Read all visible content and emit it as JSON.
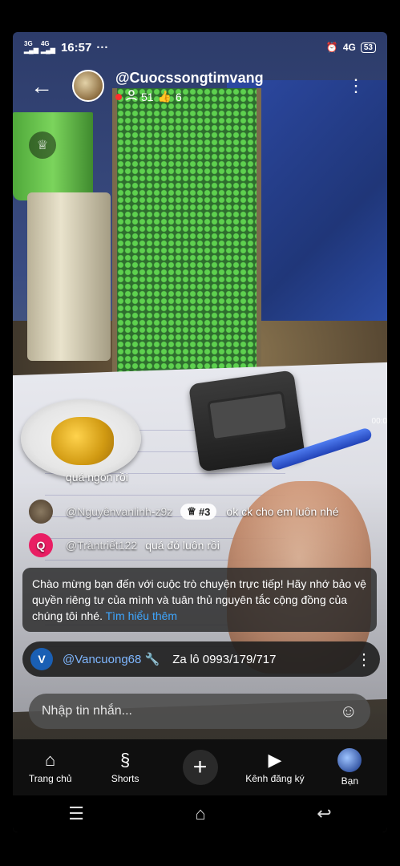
{
  "status_bar": {
    "network1": "3G",
    "network2": "4G",
    "time": "16:57",
    "dots": "···",
    "right_net": "4G",
    "battery": "53"
  },
  "header": {
    "channel_name": "@Cuocssongtimvang",
    "viewers": "51",
    "likes": "6"
  },
  "timestamp": "00:0",
  "chat": [
    {
      "avatar_color": "#6b5ca5",
      "avatar_letter": "",
      "username": "",
      "message": "quá ngon rồi"
    },
    {
      "avatar_color": "#5a4a3a",
      "avatar_letter": "",
      "username": "@Nguyênvanlinh-z9z",
      "badge": "#3",
      "message": "ok ck cho em luôn nhé"
    },
    {
      "avatar_color": "#e91e63",
      "avatar_letter": "Q",
      "username": "@Tràntriết122",
      "message": "quá đỏ luôn rồi"
    }
  ],
  "welcome": {
    "text": "Chào mừng bạn đến với cuộc trò chuyện trực tiếp! Hãy nhớ bảo vệ quyền riêng tư của mình và tuân thủ nguyên tắc cộng đồng của chúng tôi nhé.",
    "link": "Tìm hiểu thêm"
  },
  "pinned": {
    "avatar_letter": "V",
    "username": "@Vancuong68",
    "message": "Za lô 0993/179/717"
  },
  "input": {
    "placeholder": "Nhập tin nhắn..."
  },
  "nav": {
    "home": "Trang chủ",
    "shorts": "Shorts",
    "subscriptions": "Kênh đăng ký",
    "you": "Bạn"
  },
  "colors": {
    "live": "#ff2d2d",
    "link": "#3ea6ff",
    "pinned_name": "#7fb7ff"
  },
  "icons": [
    "back-arrow-icon",
    "person-icon",
    "thumb-up-icon",
    "more-vert-icon",
    "crown-icon",
    "wrench-icon",
    "emoji-icon",
    "home-icon",
    "shorts-icon",
    "plus-icon",
    "subscriptions-icon",
    "menu-icon",
    "home-nav-icon",
    "back-nav-icon"
  ]
}
